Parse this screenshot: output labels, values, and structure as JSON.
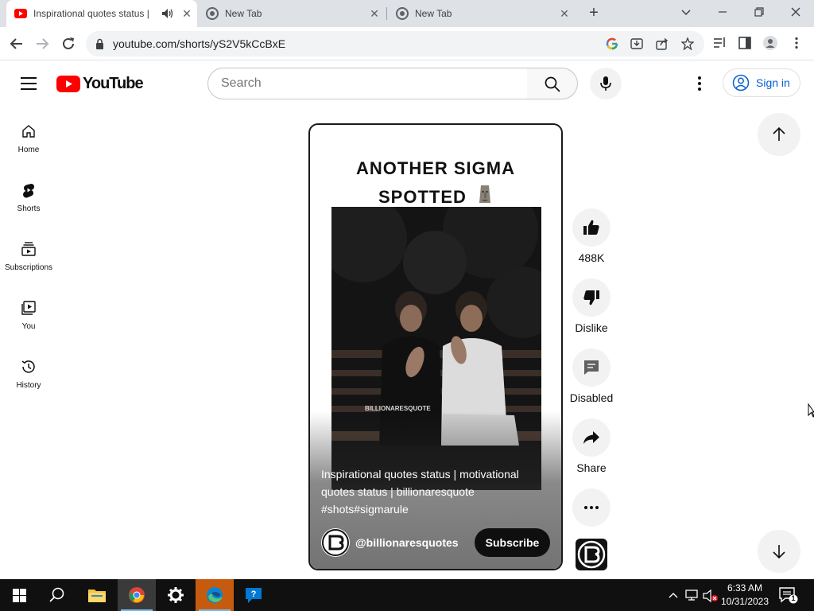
{
  "browser": {
    "tabs": [
      {
        "title": "Inspirational quotes status |",
        "active": true
      },
      {
        "title": "New Tab",
        "active": false
      },
      {
        "title": "New Tab",
        "active": false
      }
    ],
    "url": "youtube.com/shorts/yS2V5kCcBxE"
  },
  "masthead": {
    "logo_text": "YouTube",
    "search_placeholder": "Search",
    "signin_label": "Sign in"
  },
  "sidebar": {
    "items": [
      {
        "label": "Home",
        "icon": "home-icon"
      },
      {
        "label": "Shorts",
        "icon": "shorts-icon"
      },
      {
        "label": "Subscriptions",
        "icon": "subscriptions-icon"
      },
      {
        "label": "You",
        "icon": "you-icon"
      },
      {
        "label": "History",
        "icon": "history-icon"
      }
    ]
  },
  "short": {
    "title_line1": "ANOTHER SIGMA",
    "title_line2": "SPOTTED",
    "watermark": "BILLIONARESQUOTE",
    "caption": "Inspirational quotes status | motivational quotes status | billionaresquote #shots#sigmarule",
    "channel": "@billionaresquotes",
    "subscribe_label": "Subscribe"
  },
  "actions": {
    "like_count": "488K",
    "dislike_label": "Dislike",
    "comments_label": "Disabled",
    "share_label": "Share"
  },
  "taskbar": {
    "time": "6:33 AM",
    "date": "10/31/2023",
    "notification_count": "1"
  },
  "colors": {
    "youtube_red": "#ff0000",
    "link_blue": "#065fd4",
    "taskbar_bg": "#101010"
  }
}
